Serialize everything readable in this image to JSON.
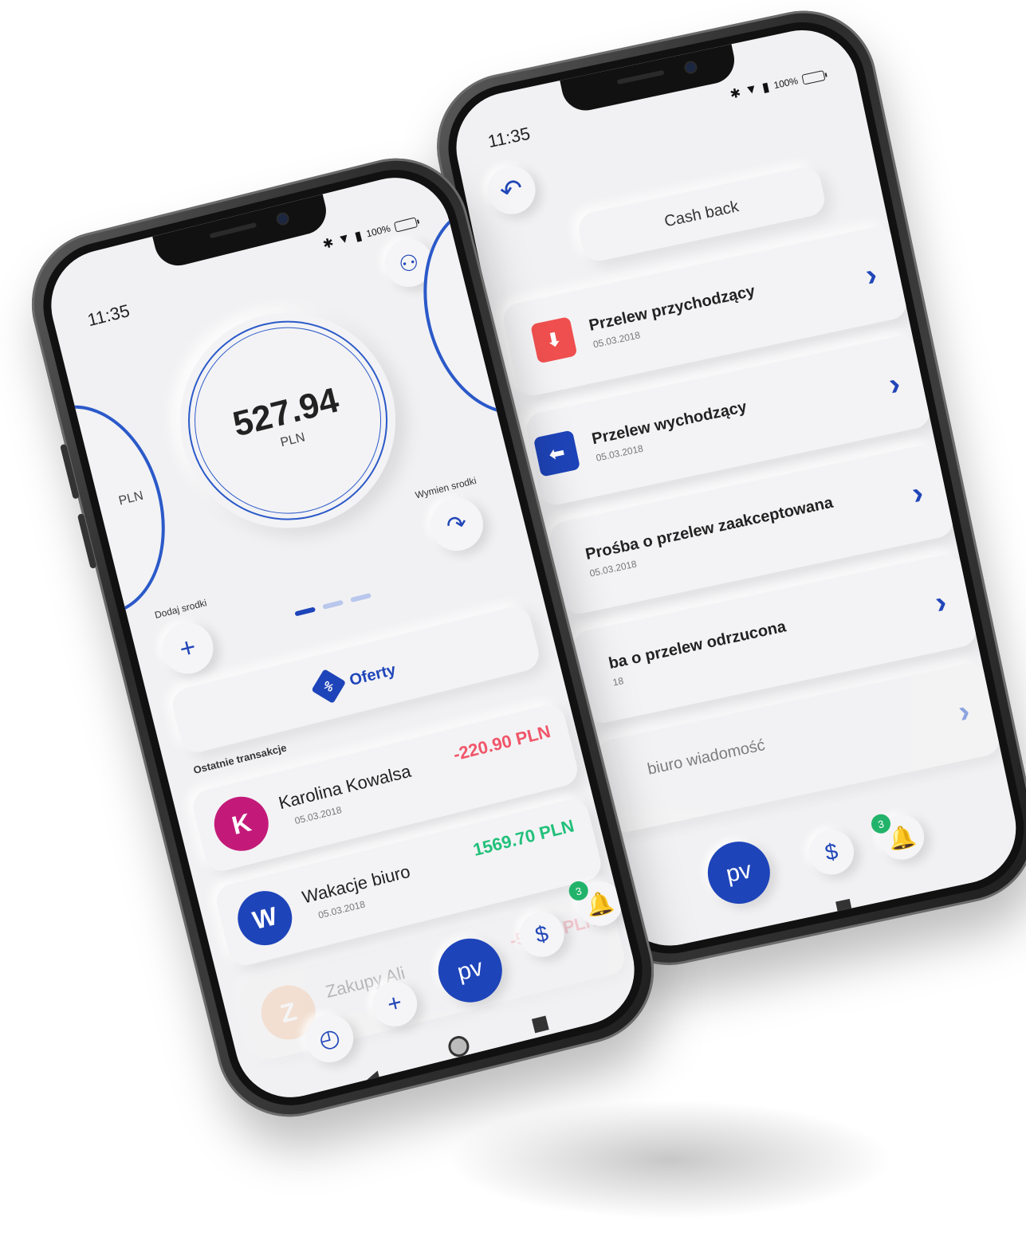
{
  "colors": {
    "accent": "#1e44b9",
    "negative": "#f0566a",
    "positive": "#22c07a",
    "screen_bg": "#f1f1f3",
    "incoming_icon": "#ef4f4f",
    "outgoing_icon": "#1e44b9",
    "avatar_k": "#c31a7a",
    "avatar_w": "#1e44b9",
    "avatar_z": "#f2b07a"
  },
  "back_phone": {
    "status": {
      "time": "11:35",
      "battery": "100%"
    },
    "back_icon": "back-arrow-icon",
    "title": "Cash back",
    "rows": [
      {
        "title": "Przelew przychodzący",
        "date": "05.03.2018",
        "icon": "incoming-transfer-icon"
      },
      {
        "title": "Przelew wychodzący",
        "date": "05.03.2018",
        "icon": "outgoing-transfer-icon"
      },
      {
        "title": "Prośba o przelew zaakceptowana",
        "date": "05.03.2018"
      },
      {
        "title": "ba o przelew odrzucona",
        "date": "18"
      },
      {
        "title": "biuro wiadomość",
        "date": ""
      }
    ],
    "tabbar": {
      "pv": "pv",
      "dollar": "$",
      "bell_badge": "3"
    }
  },
  "front_phone": {
    "status": {
      "time": "11:35",
      "battery": "100%"
    },
    "balance": {
      "amount": "527.94",
      "currency": "PLN"
    },
    "left_card_currency": "PLN",
    "add_funds_label": "Dodaj srodki",
    "exchange_label": "Wymien srodki",
    "offers_label": "Oferty",
    "recent_label": "Ostatnie transakcje",
    "transactions": [
      {
        "initial": "K",
        "name": "Karolina Kowalsa",
        "date": "05.03.2018",
        "amount": "-220.90 PLN"
      },
      {
        "initial": "W",
        "name": "Wakacje biuro",
        "date": "05.03.2018",
        "amount": "1569.70 PLN"
      },
      {
        "initial": "Z",
        "name": "Zakupy Ali",
        "date": "",
        "amount": "-55.89 PLN"
      }
    ],
    "tabbar": {
      "pv": "pv",
      "dollar": "$",
      "bell_badge": "3",
      "plus": "+"
    }
  }
}
